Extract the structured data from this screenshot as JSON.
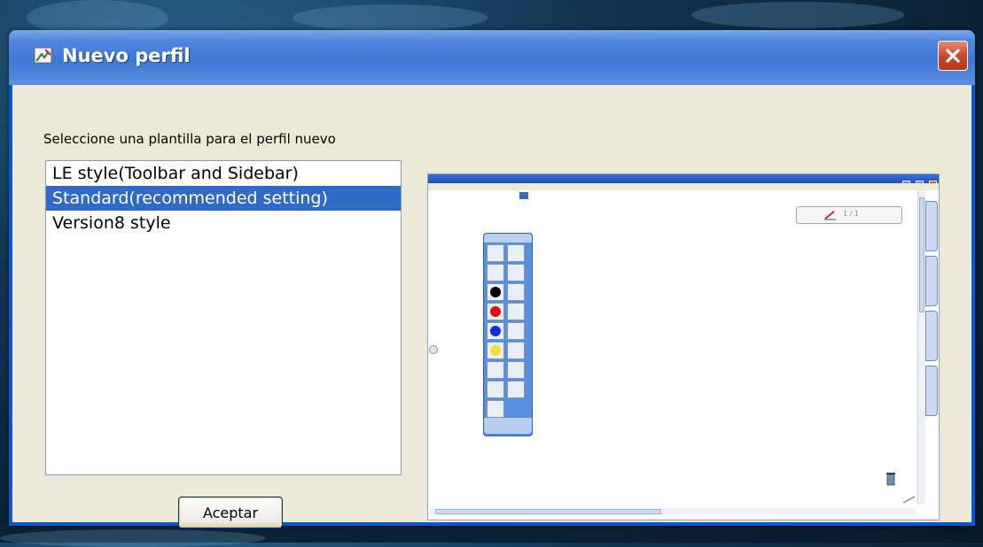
{
  "window": {
    "title": "Nuevo perfil"
  },
  "dialog": {
    "prompt": "Seleccione una plantilla para el perfil nuevo",
    "templates": [
      {
        "label": "LE style(Toolbar and Sidebar)",
        "selected": false
      },
      {
        "label": "Standard(recommended setting)",
        "selected": true
      },
      {
        "label": "Version8 style",
        "selected": false
      }
    ],
    "ok_label": "Aceptar"
  },
  "preview": {
    "page_indicator": "1 / 1",
    "toolbar_colors": [
      "#000000",
      "#e01010",
      "#1030e0",
      "#f0e030"
    ]
  },
  "colors": {
    "titlebar": "#3f78d6",
    "selection": "#316ac5",
    "client_bg": "#ece9d8"
  }
}
